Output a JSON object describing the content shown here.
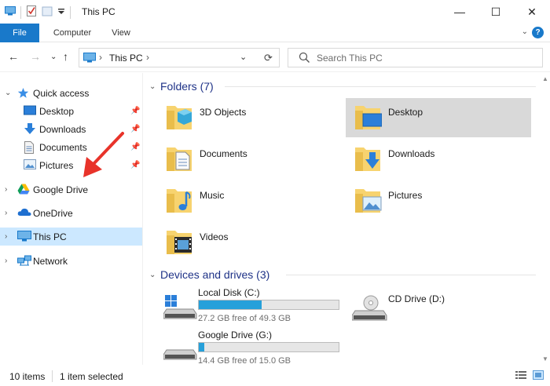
{
  "window": {
    "title": "This PC",
    "minimize_glyph": "—",
    "maximize_glyph": "☐",
    "close_glyph": "✕"
  },
  "ribbon": {
    "tabs": [
      "File",
      "Computer",
      "View"
    ],
    "help": "?"
  },
  "address_bar": {
    "back": "←",
    "forward": "→",
    "recent": "⌄",
    "up": "↑",
    "separator": "›",
    "path": "This PC",
    "dropdown": "⌄",
    "refresh": "⟳"
  },
  "search": {
    "placeholder": "Search This PC"
  },
  "sidebar": {
    "quick_access": "Quick access",
    "quick_items": [
      "Desktop",
      "Downloads",
      "Documents",
      "Pictures"
    ],
    "roots": [
      "Google Drive",
      "OneDrive",
      "This PC",
      "Network"
    ],
    "selected": "This PC"
  },
  "folders_group": {
    "label": "Folders (7)",
    "items": [
      "3D Objects",
      "Desktop",
      "Documents",
      "Downloads",
      "Music",
      "Pictures",
      "Videos"
    ],
    "selected": "Desktop"
  },
  "drives_group": {
    "label": "Devices and drives (3)",
    "drives": [
      {
        "name": "Local Disk (C:)",
        "free_text": "27.2 GB free of 49.3 GB",
        "used_fraction": 0.448
      },
      {
        "name": "CD Drive (D:)",
        "free_text": "",
        "used_fraction": null
      },
      {
        "name": "Google Drive (G:)",
        "free_text": "14.4 GB free of 15.0 GB",
        "used_fraction": 0.04
      }
    ]
  },
  "status_bar": {
    "item_count": "10 items",
    "selection": "1 item selected"
  },
  "colors": {
    "accent": "#1979ca",
    "selection": "#cce8ff",
    "progress": "#26a0da",
    "annotation_arrow": "#e8332a",
    "group_header": "#1e3287"
  },
  "icons": {
    "quick_access": "star-icon",
    "pin": "pin-icon",
    "google_drive": "google-drive-icon",
    "onedrive": "cloud-icon",
    "this_pc": "monitor-icon",
    "network": "network-icon"
  }
}
